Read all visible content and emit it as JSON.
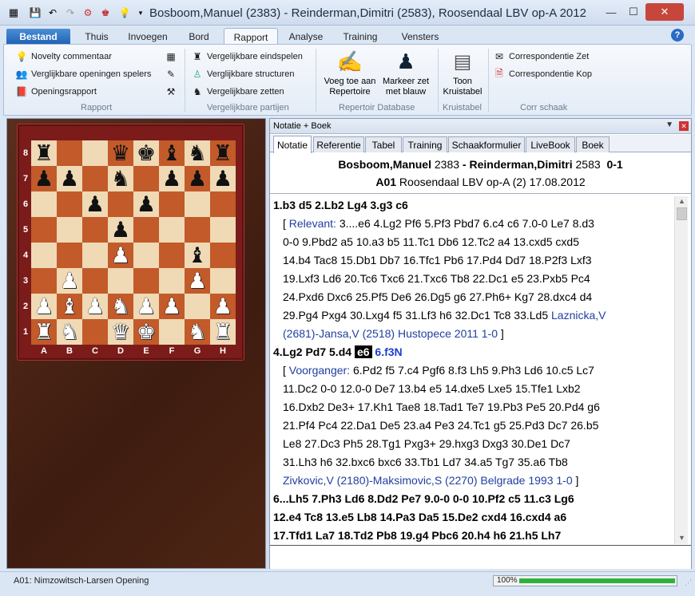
{
  "window": {
    "title": "Bosboom,Manuel (2383) - Reinderman,Dimitri (2583), Roosendaal LBV op-A 2012",
    "controls": [
      "minimize",
      "maximize",
      "close"
    ]
  },
  "ribbon_tabs": [
    "Bestand",
    "Thuis",
    "Invoegen",
    "Bord",
    "Rapport",
    "Analyse",
    "Training",
    "Vensters"
  ],
  "active_tab": "Rapport",
  "ribbon": {
    "rapport": {
      "items": [
        "Novelty commentaar",
        "Verglijkbare openingen spelers",
        "Openingsrapport"
      ],
      "label": "Rapport"
    },
    "vergelijkbare": {
      "items": [
        "Vergelijkbare eindspelen",
        "Verglijkbare structuren",
        "Vergelijkbare zetten"
      ],
      "label": "Vergelijkbare partijen"
    },
    "repertoir": {
      "btn1": [
        "Voeg toe aan",
        "Repertoire"
      ],
      "btn2": [
        "Markeer zet",
        "met blauw"
      ],
      "label": "Repertoir Database"
    },
    "kruistabel": {
      "btn": [
        "Toon",
        "Kruistabel"
      ],
      "label": "Kruistabel"
    },
    "corr": {
      "items": [
        "Correspondentie Zet",
        "Correspondentie Kop"
      ],
      "label": "Corr schaak"
    }
  },
  "board": {
    "ranks": [
      "8",
      "7",
      "6",
      "5",
      "4",
      "3",
      "2",
      "1"
    ],
    "files": [
      "A",
      "B",
      "C",
      "D",
      "E",
      "F",
      "G",
      "H"
    ],
    "position": [
      [
        "br",
        "",
        "",
        "bq",
        "bk",
        "bb",
        "bn",
        "br"
      ],
      [
        "bp",
        "bp",
        "",
        "bn",
        "",
        "bp",
        "bp",
        "bp"
      ],
      [
        "",
        "",
        "bp",
        "",
        "bp",
        "",
        "",
        ""
      ],
      [
        "",
        "",
        "",
        "bp",
        "",
        "",
        "",
        ""
      ],
      [
        "",
        "",
        "",
        "wp",
        "",
        "",
        "bb",
        ""
      ],
      [
        "",
        "wp",
        "",
        "",
        "",
        "",
        "wp",
        ""
      ],
      [
        "wp",
        "wb",
        "wp",
        "wn",
        "wp",
        "wp",
        "",
        "wp"
      ],
      [
        "wr",
        "wn",
        "",
        "wq",
        "wk",
        "",
        "wn",
        "wr"
      ]
    ]
  },
  "notation": {
    "panel_title": "Notatie + Boek",
    "tabs": [
      "Notatie",
      "Referentie",
      "Tabel",
      "Training",
      "Schaakformulier",
      "LiveBook",
      "Boek"
    ],
    "active_tab": "Notatie",
    "header": {
      "white": "Bosboom,Manuel",
      "white_elo": "2383",
      "sep": " - ",
      "black": "Reinderman,Dimitri",
      "black_elo": "2583",
      "result": "0-1",
      "eco": "A01",
      "event": "Roosendaal LBV op-A (2) 17.08.2012"
    },
    "lines": [
      {
        "type": "main",
        "text": "1.b3   d5  2.Lb2  Lg4  3.g3  c6"
      },
      {
        "type": "var",
        "prefix": "[ ",
        "label": "Relevant:",
        "text": " 3....e6  4.Lg2  Pf6  5.Pf3  Pbd7  6.c4  c6  7.0-0  Le7  8.d3"
      },
      {
        "type": "var",
        "text": "0-0  9.Pbd2  a5  10.a3  b5  11.Tc1  Db6  12.Tc2  a4  13.cxd5  cxd5"
      },
      {
        "type": "var",
        "text": "14.b4  Tac8  15.Db1  Db7  16.Tfc1  Pb6  17.Pd4  Dd7  18.P2f3  Lxf3"
      },
      {
        "type": "var",
        "text": "19.Lxf3  Ld6  20.Tc6  Txc6  21.Txc6  Tb8  22.Dc1  e5  23.Pxb5  Pc4"
      },
      {
        "type": "var",
        "text": "24.Pxd6  Dxc6  25.Pf5  De6  26.Dg5  g6  27.Ph6+  Kg7  28.dxc4  d4"
      },
      {
        "type": "var",
        "text": "29.Pg4  Pxg4  30.Lxg4  f5  31.Lf3  h6  32.Dc1  Tc8  33.Ld5 ",
        "ref": "Laznicka,V"
      },
      {
        "type": "var",
        "ref": "(2681)-Jansa,V (2518) Hustopece 2011 1-0",
        "suffix": " ]"
      },
      {
        "type": "cur",
        "pre": "4.Lg2  Pd7  5.d4 ",
        "cur": "e6",
        "last": "6.f3N"
      },
      {
        "type": "var",
        "prefix": "[ ",
        "label": "Voorganger:",
        "text": " 6.Pd2  f5  7.c4  Pgf6  8.f3  Lh5  9.Ph3  Ld6  10.c5  Lc7"
      },
      {
        "type": "var",
        "text": "11.Dc2  0-0  12.0-0  De7  13.b4  e5  14.dxe5  Lxe5  15.Tfe1  Lxb2"
      },
      {
        "type": "var",
        "text": "16.Dxb2  De3+  17.Kh1  Tae8  18.Tad1  Te7  19.Pb3  Pe5  20.Pd4  g6"
      },
      {
        "type": "var",
        "text": "21.Pf4  Pc4  22.Da1  De5  23.a4  Pe3  24.Tc1  g5  25.Pd3  Dc7  26.b5"
      },
      {
        "type": "var",
        "text": "Le8  27.Dc3  Ph5  28.Tg1  Pxg3+  29.hxg3  Dxg3  30.De1  Dc7"
      },
      {
        "type": "var",
        "text": "31.Lh3  h6  32.bxc6  bxc6  33.Tb1  Ld7  34.a5  Tg7  35.a6  Tb8"
      },
      {
        "type": "var",
        "ref": "Zivkovic,V (2180)-Maksimovic,S (2270) Belgrade 1993 1-0",
        "suffix": " ]"
      },
      {
        "type": "main",
        "text": "6...Lh5  7.Ph3  Ld6  8.Dd2  Pe7  9.0-0  0-0  10.Pf2  c5  11.c3  Lg6"
      },
      {
        "type": "main",
        "text": "12.e4  Tc8  13.e5  Lb8  14.Pa3  Da5  15.De2  cxd4  16.cxd4  a6"
      },
      {
        "type": "main",
        "text": "17.Tfd1  La7  18.Td2  Pb8  19.g4  Pbc6  20.h4  h6  21.h5  Lh7"
      }
    ]
  },
  "status": {
    "opening": "A01: Nimzowitsch-Larsen Opening",
    "progress_label": "100%",
    "progress_value": 100
  },
  "colors": {
    "board_light": "#f0d9b5",
    "board_dark": "#c25a2a",
    "frame": "#7b1c1a",
    "link_blue": "#2040a0",
    "progress_green": "#2fb13c"
  }
}
